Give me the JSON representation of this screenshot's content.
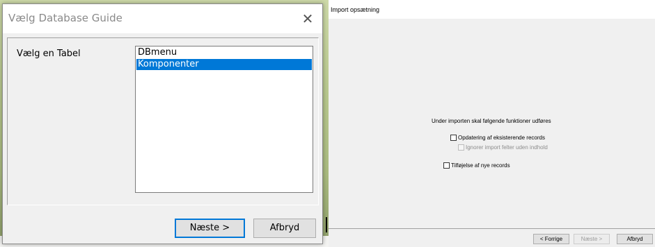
{
  "dialog": {
    "title": "Vælg Database Guide",
    "close_glyph": "✕",
    "table_label": "Vælg en Tabel",
    "tables": [
      {
        "label": "DBmenu",
        "selected": false
      },
      {
        "label": "Komponenter",
        "selected": true
      }
    ],
    "buttons": {
      "next_label": "Næste >",
      "cancel_label": "Afbryd"
    }
  },
  "import_panel": {
    "title": "Import opsætning",
    "heading": "Under importen skal følgende funktioner udføres",
    "options": {
      "update_existing": {
        "label": "Opdatering af eksisterende records",
        "checked": false,
        "enabled": true
      },
      "ignore_empty": {
        "label": "Ignorer import felter uden indhold",
        "checked": false,
        "enabled": false
      },
      "add_new": {
        "label": "Tilføjelse af nye records",
        "checked": false,
        "enabled": true
      }
    },
    "buttons": {
      "previous_label": "< Forrige",
      "next_label": "Næste >",
      "cancel_label": "Afbryd"
    }
  },
  "colors": {
    "selection": "#0078d7",
    "window_background": "#f0f0f0",
    "button_face": "#e1e1e1"
  }
}
